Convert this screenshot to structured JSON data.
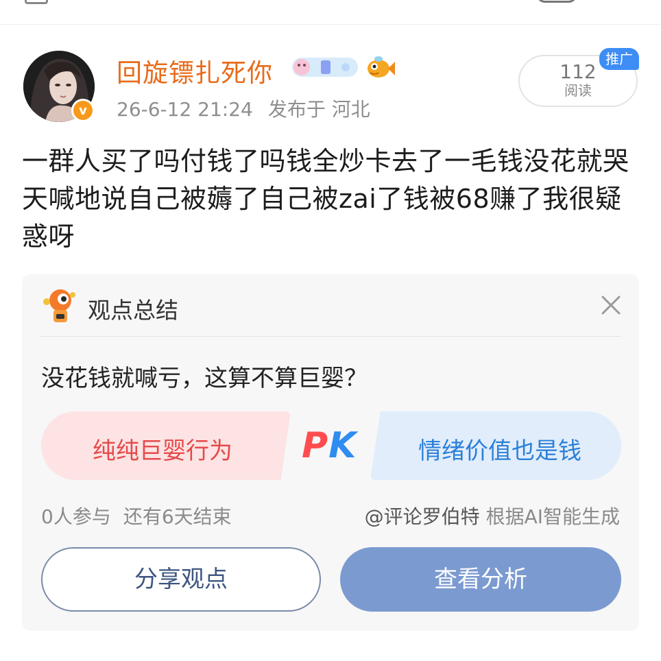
{
  "header": {
    "username": "回旋镖扎死你",
    "timestamp": "26-6-12 21:24",
    "location": "发布于 河北",
    "read_count": "112",
    "read_label": "阅读",
    "promo_tag": "推广",
    "verified_icon": "v-verified-badge"
  },
  "post": {
    "text": "一群人买了吗付钱了吗钱全炒卡去了一毛钱没花就哭天喊地说自己被薅了自己被zai了钱被68赚了我很疑惑呀"
  },
  "card": {
    "title": "观点总结",
    "question": "没花钱就喊亏，这算不算巨婴？",
    "option_left": "纯纯巨婴行为",
    "option_right": "情绪价值也是钱",
    "pk_p": "P",
    "pk_k": "K",
    "participants": "0人参与",
    "remaining": "还有6天结束",
    "generated_by": "@评论罗伯特",
    "generated_suffix": "根据AI智能生成",
    "share_button": "分享观点",
    "view_button": "查看分析"
  },
  "colors": {
    "username": "#e86b1a",
    "promo": "#3d8df5",
    "left_option_text": "#e54a4a",
    "right_option_text": "#2b7fd8",
    "view_button_bg": "#7b9ad0"
  }
}
